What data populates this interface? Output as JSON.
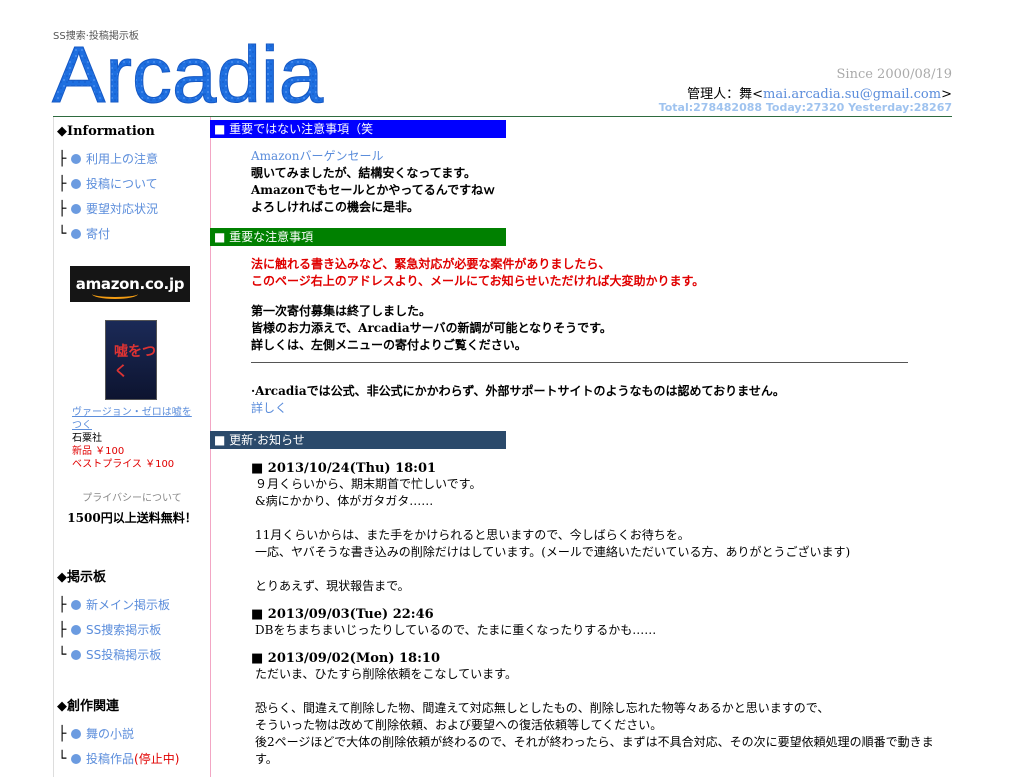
{
  "header": {
    "tagline": "SS捜索·投稿掲示板",
    "logo_text": "Arcadia",
    "since": "Since 2000/08/19",
    "admin_prefix": "管理人：舞<",
    "admin_email": "mai.arcadia.su@gmail.com",
    "admin_suffix": ">",
    "counter": "Total:278482088 Today:27320 Yesterday:28267"
  },
  "sidebar": {
    "info_head": "◆Information",
    "info_items": [
      "利用上の注意",
      "投稿について",
      "要望対応状況",
      "寄付"
    ],
    "amazon_logo": "amazon.co.jp",
    "book_title": "嘘をつく",
    "product_link": "ヴァージョン・ゼロは嘘をつく",
    "publisher": "石粟社",
    "new_price": "新品 ￥100",
    "best_price": "ベストプライス ￥100",
    "privacy": "プライバシーについて",
    "shipping": "1500円以上送料無料！",
    "board_head": "◆掲示板",
    "board_items": [
      "新メイン掲示板",
      "SS捜索掲示板",
      "SS投稿掲示板"
    ],
    "create_head": "◆創作関連",
    "create_item1": "舞の小説",
    "create_item2": "投稿作品",
    "create_item2_note": "(停止中)"
  },
  "notice1": {
    "title": "■ 重要ではない注意事項（笑",
    "link": "Amazonバーゲンセール",
    "lines": [
      "覗いてみましたが、結構安くなってます。",
      "Amazonでもセールとかやってるんですねｗ",
      "よろしければこの機会に是非。"
    ]
  },
  "notice2": {
    "title": "■ 重要な注意事項",
    "red_lines": [
      "法に触れる書き込みなど、緊急対応が必要な案件がありましたら、",
      "このページ右上のアドレスより、メールにてお知らせいただければ大変助かります。"
    ],
    "lines": [
      "第一次寄付募集は終了しました。",
      "皆様のお力添えで、Arcadiaサーバの新調が可能となりそうです。",
      "詳しくは、左側メニューの寄付よりご覧ください。"
    ],
    "support_line": "·Arcadiaでは公式、非公式にかかわらず、外部サポートサイトのようなものは認めておりません。",
    "detail_link": "詳しく"
  },
  "news": {
    "title": "■ 更新·お知らせ",
    "entries": [
      {
        "date": "■ 2013/10/24(Thu) 18:01",
        "body": [
          "９月くらいから、期末期首で忙しいです。",
          "&病にかかり、体がガタガタ……",
          "",
          "11月くらいからは、また手をかけられると思いますので、今しばらくお待ちを。",
          "一応、ヤバそうな書き込みの削除だけはしています。(メールで連絡いただいている方、ありがとうございます)",
          "",
          "とりあえず、現状報告まで。"
        ]
      },
      {
        "date": "■ 2013/09/03(Tue) 22:46",
        "body": [
          "DBをちまちまいじったりしているので、たまに重くなったりするかも……"
        ]
      },
      {
        "date": "■ 2013/09/02(Mon) 18:10",
        "body": [
          "ただいま、ひたすら削除依頼をこなしています。",
          "",
          "恐らく、間違えて削除した物、間違えて対応無しとしたもの、削除し忘れた物等々あるかと思いますので、",
          "そういった物は改めて削除依頼、および要望への復活依頼等してください。",
          "後2ページほどで大体の削除依頼が終わるので、それが終わったら、まずは不具合対応、その次に要望依頼処理の順番で動きます。"
        ]
      }
    ]
  },
  "colors": {
    "accent": "#5b8ddb",
    "logo": "#1e6fe0",
    "bar_blue": "#0000ff",
    "bar_green": "#008000",
    "bar_navy": "#2b4a6b",
    "warning": "#e00000"
  },
  "icons": {
    "bullet": "dot-icon",
    "tree": "tree-branch-icon"
  }
}
